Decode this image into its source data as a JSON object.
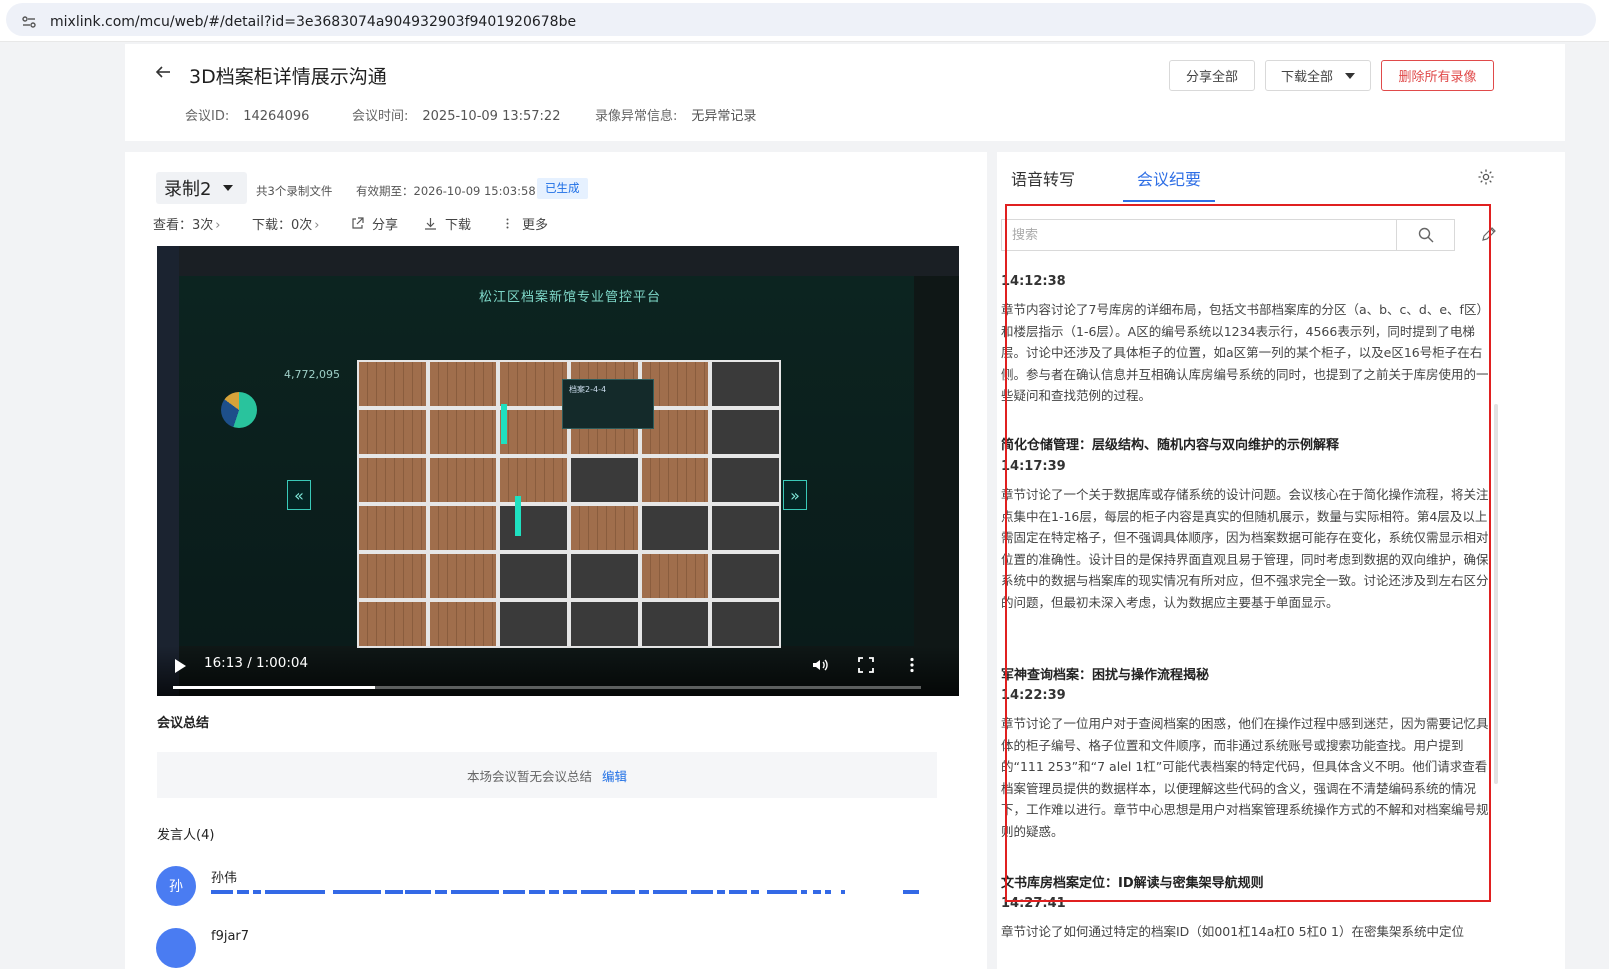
{
  "browser": {
    "url": "mixlink.com/mcu/web/#/detail?id=3e3683074a904932903f9401920678be"
  },
  "header": {
    "title": "3D档案柜详情展示沟通",
    "meeting_id_label": "会议ID:",
    "meeting_id": "14264096",
    "meeting_time_label": "会议时间:",
    "meeting_time": "2025-10-09 13:57:22",
    "anomaly_label": "录像异常信息:",
    "anomaly_value": "无异常记录",
    "share_all": "分享全部",
    "download_all": "下载全部",
    "delete_all": "删除所有录像",
    "danger_color": "#e04a4a"
  },
  "recording": {
    "selected": "录制2",
    "file_count": "共3个录制文件",
    "expiry": "有效期至：2026-10-09 15:03:58",
    "status_tag": "已生成",
    "views": "查看：3次",
    "downloads": "下载：0次",
    "share": "分享",
    "download": "下载",
    "more": "更多"
  },
  "video": {
    "screen_title": "松江区档案新馆专业管控平台",
    "stat_number": "4,772,095",
    "time": "16:13 / 1:00:04",
    "progress": 0.27,
    "popup_title": "档案2-4-4"
  },
  "summary": {
    "title": "会议总结",
    "empty_text": "本场会议暂无会议总结",
    "edit": "编辑"
  },
  "speakers": {
    "title": "发言人(4)",
    "items": [
      {
        "initial": "孙",
        "name": "孙伟"
      },
      {
        "initial": "",
        "name": "f9jar7"
      }
    ]
  },
  "panel": {
    "tab_transcript": "语音转写",
    "tab_minutes": "会议纪要",
    "search_placeholder": "搜索",
    "accent_color": "#2f6fe5",
    "chapters": [
      {
        "time": "14:12:38",
        "body": "章节内容讨论了7号库房的详细布局，包括文书部档案库的分区（a、b、c、d、e、f区）和楼层指示（1-6层）。A区的编号系统以1234表示行，4566表示列，同时提到了电梯层。讨论中还涉及了具体柜子的位置，如a区第一列的某个柜子，以及e区16号柜子在右侧。参与者在确认信息并互相确认库房编号系统的同时，也提到了之前关于库房使用的一些疑问和查找范例的过程。"
      },
      {
        "title": "简化仓储管理：层级结构、随机内容与双向维护的示例解释",
        "time": "14:17:39",
        "body": "章节讨论了一个关于数据库或存储系统的设计问题。会议核心在于简化操作流程，将关注点集中在1-16层，每层的柜子内容是真实的但随机展示，数量与实际相符。第4层及以上需固定在特定格子，但不强调具体顺序，因为档案数据可能存在变化，系统仅需显示相对位置的准确性。设计目的是保持界面直观且易于管理，同时考虑到数据的双向维护，确保系统中的数据与档案库的现实情况有所对应，但不强求完全一致。讨论还涉及到左右区分的问题，但最初未深入考虑，认为数据应主要基于单面显示。"
      },
      {
        "title": "军神查询档案：困扰与操作流程揭秘",
        "time": "14:22:39",
        "body": "章节讨论了一位用户对于查阅档案的困惑，他们在操作过程中感到迷茫，因为需要记忆具体的柜子编号、格子位置和文件顺序，而非通过系统账号或搜索功能查找。用户提到的“111 253”和“7 alel 1杠”可能代表档案的特定代码，但具体含义不明。他们请求查看档案管理员提供的数据样本，以便理解这些代码的含义，强调在不清楚编码系统的情况下，工作难以进行。章节中心思想是用户对档案管理系统操作方式的不解和对档案编号规则的疑惑。"
      },
      {
        "title": "文书库房档案定位：ID解读与密集架导航规则",
        "time": "14:27:41",
        "body": "章节讨论了如何通过特定的档案ID（如001杠14a杠0 5杠0 1）在密集架系统中定位"
      }
    ]
  }
}
